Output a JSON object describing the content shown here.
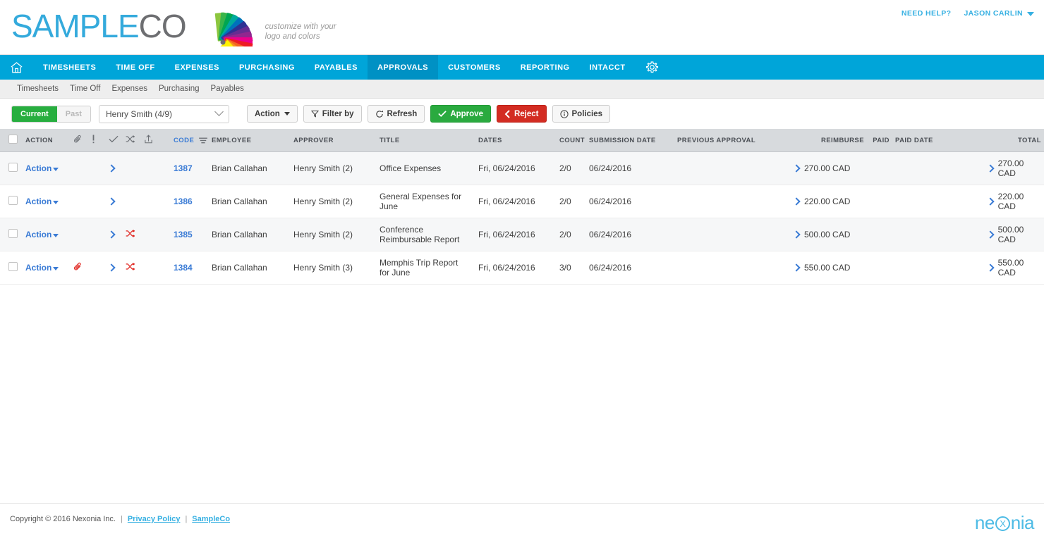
{
  "brand": {
    "logo_text_primary": "SAMPLE",
    "logo_text_secondary": "CO",
    "tagline_line1": "customize with your",
    "tagline_line2": "logo and colors",
    "help_label": "NEED HELP?",
    "user_label": "JASON CARLIN",
    "accent_blue": "#36b0e2",
    "logo_blue": "#34aadc",
    "logo_grey": "#6d6e71"
  },
  "mainnav": {
    "active": "APPROVALS",
    "bg_color": "#00a5d9",
    "active_color": "#0091c4",
    "items": [
      {
        "label": "TIMESHEETS"
      },
      {
        "label": "TIME OFF"
      },
      {
        "label": "EXPENSES"
      },
      {
        "label": "PURCHASING"
      },
      {
        "label": "PAYABLES"
      },
      {
        "label": "APPROVALS"
      },
      {
        "label": "CUSTOMERS"
      },
      {
        "label": "REPORTING"
      },
      {
        "label": "INTACCT"
      }
    ],
    "home_icon": "home-icon",
    "settings_icon": "gear-icon"
  },
  "subnav": {
    "items": [
      {
        "label": "Timesheets"
      },
      {
        "label": "Time Off"
      },
      {
        "label": "Expenses"
      },
      {
        "label": "Purchasing"
      },
      {
        "label": "Payables"
      }
    ]
  },
  "toolbar": {
    "segment_current": "Current",
    "segment_past": "Past",
    "segment_current_active": true,
    "approver_select_value": "Henry Smith (4/9)",
    "action_label": "Action",
    "filter_label": "Filter by",
    "refresh_label": "Refresh",
    "approve_label": "Approve",
    "reject_label": "Reject",
    "policies_label": "Policies",
    "approve_color": "#2aaa3f",
    "reject_color": "#d32c22"
  },
  "table": {
    "headers": {
      "action": "ACTION",
      "attachment_icon": "paperclip-icon",
      "exception_icon": "exclamation-icon",
      "approved_icon": "checkmark-icon",
      "shuffle_icon": "shuffle-icon",
      "export_icon": "upload-icon",
      "code": "CODE",
      "sort_icon": "sort-icon",
      "employee": "EMPLOYEE",
      "approver": "APPROVER",
      "title": "TITLE",
      "dates": "DATES",
      "count": "COUNT",
      "submission_date": "SUBMISSION DATE",
      "previous_approval": "PREVIOUS APPROVAL",
      "reimburse": "REIMBURSE",
      "paid": "PAID",
      "paid_date": "PAID DATE",
      "total": "TOTAL"
    },
    "rows": [
      {
        "checked": false,
        "action": "Action",
        "has_attachment": false,
        "has_shuffle": false,
        "code": "1387",
        "employee": "Brian Callahan",
        "approver": "Henry Smith (2)",
        "title": "Office Expenses",
        "dates": "Fri, 06/24/2016",
        "count": "2/0",
        "submission_date": "06/24/2016",
        "previous_approval": "",
        "reimburse": "270.00 CAD",
        "paid": "",
        "paid_date": "",
        "total": "270.00 CAD"
      },
      {
        "checked": false,
        "action": "Action",
        "has_attachment": false,
        "has_shuffle": false,
        "code": "1386",
        "employee": "Brian Callahan",
        "approver": "Henry Smith (2)",
        "title": "General Expenses for June",
        "dates": "Fri, 06/24/2016",
        "count": "2/0",
        "submission_date": "06/24/2016",
        "previous_approval": "",
        "reimburse": "220.00 CAD",
        "paid": "",
        "paid_date": "",
        "total": "220.00 CAD"
      },
      {
        "checked": false,
        "action": "Action",
        "has_attachment": false,
        "has_shuffle": true,
        "code": "1385",
        "employee": "Brian Callahan",
        "approver": "Henry Smith (2)",
        "title": "Conference Reimbursable Report",
        "dates": "Fri, 06/24/2016",
        "count": "2/0",
        "submission_date": "06/24/2016",
        "previous_approval": "",
        "reimburse": "500.00 CAD",
        "paid": "",
        "paid_date": "",
        "total": "500.00 CAD"
      },
      {
        "checked": false,
        "action": "Action",
        "has_attachment": true,
        "has_shuffle": true,
        "code": "1384",
        "employee": "Brian Callahan",
        "approver": "Henry Smith (3)",
        "title": "Memphis Trip Report for June",
        "dates": "Fri, 06/24/2016",
        "count": "3/0",
        "submission_date": "06/24/2016",
        "previous_approval": "",
        "reimburse": "550.00 CAD",
        "paid": "",
        "paid_date": "",
        "total": "550.00 CAD"
      }
    ]
  },
  "footer": {
    "copyright": "Copyright © 2016 Nexonia Inc.",
    "privacy_label": "Privacy Policy",
    "company_label": "SampleCo",
    "separator": "|",
    "brand_left": "ne",
    "brand_mark": "X",
    "brand_right": "nia"
  }
}
